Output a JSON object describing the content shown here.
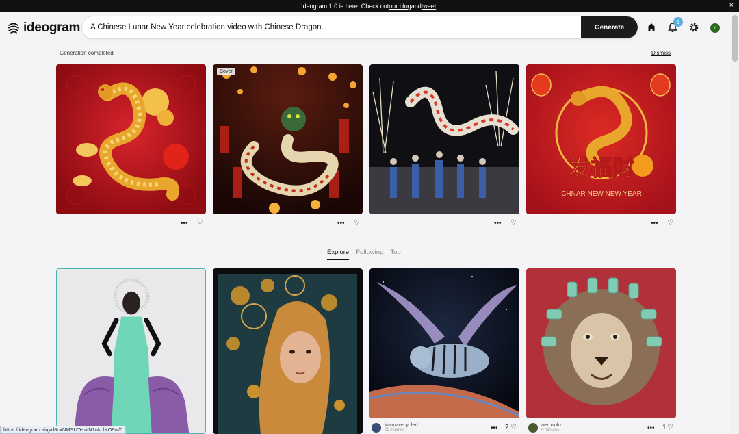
{
  "banner": {
    "prefix": "Ideogram 1.0 is here. Check out ",
    "link1": "our blog",
    "middle": " and ",
    "link2": "tweet",
    "suffix": ".",
    "close": "×"
  },
  "header": {
    "logo": "ideogram",
    "prompt_value": "A Chinese Lunar New Year celebration video with Chinese Dragon.",
    "generate_label": "Generate",
    "notification_count": "1",
    "avatar_initial": "t"
  },
  "generation": {
    "status": "Generation completed",
    "dismiss": "Dismiss",
    "cover_label": "Cover",
    "image4_text": "CHNAR NEW NEW YEAR",
    "image4_chars": "发福财"
  },
  "actions": {
    "more": "•••",
    "like": "♡"
  },
  "tabs": [
    {
      "label": "Explore",
      "active": true
    },
    {
      "label": "Following",
      "active": false
    },
    {
      "label": "Top",
      "active": false
    }
  ],
  "feed": [
    {
      "user": "",
      "time": "",
      "likes": ""
    },
    {
      "user": "",
      "time": "",
      "likes": ""
    },
    {
      "user": "karmarecycled",
      "time": "22 minutes",
      "likes": "2"
    },
    {
      "user": "aerosolo",
      "time": "4 minutes",
      "likes": "1"
    }
  ],
  "statusbar": {
    "url": "https://ideogram.ai/g/d8cxNMSUTemfN1nkLlKO9w/0"
  },
  "colors": {
    "accent": "#1b1b1b",
    "badge": "#5aaee0",
    "avatar": "#2d6a1f",
    "red": "#b5121b"
  }
}
